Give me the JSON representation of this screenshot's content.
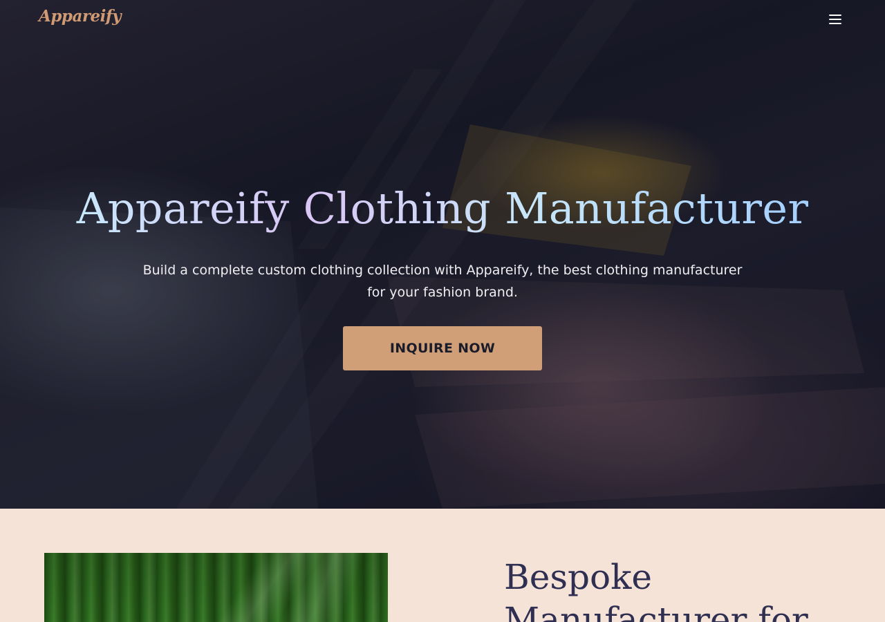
{
  "header": {
    "logo_text": "Appareify",
    "menu_icon": "hamburger-menu-icon"
  },
  "hero": {
    "title": "Appareify Clothing Manufacturer",
    "subtitle": "Build a complete custom clothing collection with Appareify, the best clothing manufacturer for your fashion brand.",
    "cta_label": "INQUIRE NOW"
  },
  "section_two": {
    "heading": "Bespoke Manufacturer for"
  },
  "colors": {
    "brand_accent": "#d09f78",
    "hero_background": "#1a1b28",
    "section_background": "#f6e3d8",
    "heading_text": "#2f2f52"
  }
}
